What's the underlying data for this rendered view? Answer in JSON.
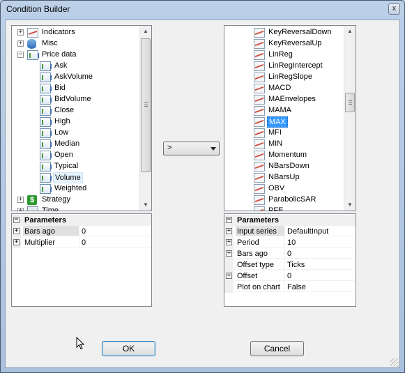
{
  "window": {
    "title": "Condition Builder",
    "close_label": "x"
  },
  "left_tree": {
    "items": [
      {
        "label": "Indicators",
        "icon": "indicator-line-icon",
        "level": 0,
        "expander": "+"
      },
      {
        "label": "Misc",
        "icon": "database-icon",
        "level": 0,
        "expander": "+"
      },
      {
        "label": "Price data",
        "icon": "bar-chart-icon",
        "level": 0,
        "expander": "-"
      },
      {
        "label": "Ask",
        "icon": "bar-chart-icon",
        "level": 1
      },
      {
        "label": "AskVolume",
        "icon": "bar-chart-icon",
        "level": 1
      },
      {
        "label": "Bid",
        "icon": "bar-chart-icon",
        "level": 1
      },
      {
        "label": "BidVolume",
        "icon": "bar-chart-icon",
        "level": 1
      },
      {
        "label": "Close",
        "icon": "bar-chart-icon",
        "level": 1
      },
      {
        "label": "High",
        "icon": "bar-chart-icon",
        "level": 1
      },
      {
        "label": "Low",
        "icon": "bar-chart-icon",
        "level": 1
      },
      {
        "label": "Median",
        "icon": "bar-chart-icon",
        "level": 1
      },
      {
        "label": "Open",
        "icon": "bar-chart-icon",
        "level": 1
      },
      {
        "label": "Typical",
        "icon": "bar-chart-icon",
        "level": 1
      },
      {
        "label": "Volume",
        "icon": "bar-chart-icon",
        "level": 1,
        "state": "hover"
      },
      {
        "label": "Weighted",
        "icon": "bar-chart-icon",
        "level": 1
      },
      {
        "label": "Strategy",
        "icon": "strategy-icon",
        "level": 0,
        "expander": "+"
      },
      {
        "label": "Time",
        "icon": "time-icon",
        "level": 0,
        "expander": "+"
      }
    ]
  },
  "left_params": {
    "header": "Parameters",
    "rows": [
      {
        "name": "Bars ago",
        "value": "0",
        "expander": "+",
        "selected": true
      },
      {
        "name": "Multiplier",
        "value": "0",
        "expander": "+"
      }
    ]
  },
  "operator": {
    "value": ">"
  },
  "right_tree": {
    "items": [
      {
        "label": "KeyReversalDown"
      },
      {
        "label": "KeyReversalUp"
      },
      {
        "label": "LinReg"
      },
      {
        "label": "LinRegIntercept"
      },
      {
        "label": "LinRegSlope"
      },
      {
        "label": "MACD"
      },
      {
        "label": "MAEnvelopes"
      },
      {
        "label": "MAMA"
      },
      {
        "label": "MAX",
        "state": "selected"
      },
      {
        "label": "MFI"
      },
      {
        "label": "MIN"
      },
      {
        "label": "Momentum"
      },
      {
        "label": "NBarsDown"
      },
      {
        "label": "NBarsUp"
      },
      {
        "label": "OBV"
      },
      {
        "label": "ParabolicSAR"
      },
      {
        "label": "PFE"
      }
    ]
  },
  "right_params": {
    "header": "Parameters",
    "rows": [
      {
        "name": "Input series",
        "value": "DefaultInput",
        "expander": "+",
        "selected": true
      },
      {
        "name": "Period",
        "value": "10",
        "expander": "+"
      },
      {
        "name": "Bars ago",
        "value": "0",
        "expander": "+"
      },
      {
        "name": "Offset type",
        "value": "Ticks"
      },
      {
        "name": "Offset",
        "value": "0",
        "expander": "+"
      },
      {
        "name": "Plot on chart",
        "value": "False"
      }
    ]
  },
  "buttons": {
    "ok": "OK",
    "cancel": "Cancel"
  }
}
